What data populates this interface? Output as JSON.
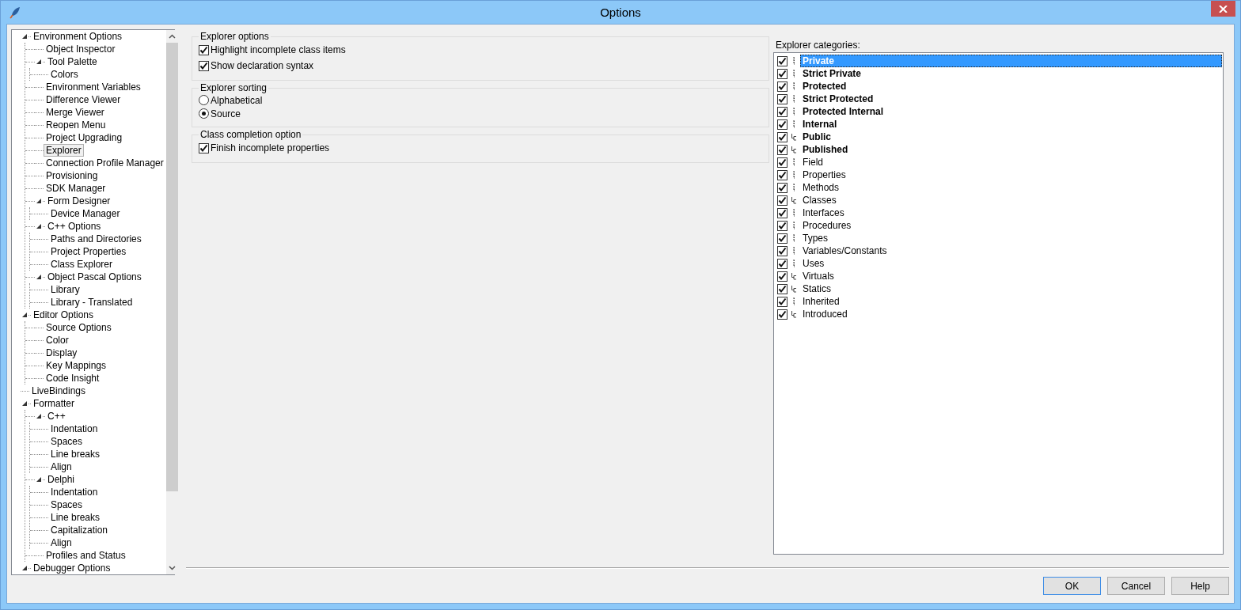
{
  "window": {
    "title": "Options"
  },
  "tree": [
    {
      "label": "Environment Options",
      "expanded": true,
      "selected": false,
      "children": [
        {
          "label": "Object Inspector",
          "selected": false
        },
        {
          "label": "Tool Palette",
          "expanded": true,
          "selected": false,
          "children": [
            {
              "label": "Colors",
              "selected": false
            }
          ]
        },
        {
          "label": "Environment Variables",
          "selected": false
        },
        {
          "label": "Difference Viewer",
          "selected": false
        },
        {
          "label": "Merge Viewer",
          "selected": false
        },
        {
          "label": "Reopen Menu",
          "selected": false
        },
        {
          "label": "Project Upgrading",
          "selected": false
        },
        {
          "label": "Explorer",
          "selected": true
        },
        {
          "label": "Connection Profile Manager",
          "selected": false
        },
        {
          "label": "Provisioning",
          "selected": false
        },
        {
          "label": "SDK Manager",
          "selected": false
        },
        {
          "label": "Form Designer",
          "expanded": true,
          "selected": false,
          "children": [
            {
              "label": "Device Manager",
              "selected": false
            }
          ]
        },
        {
          "label": "C++ Options",
          "expanded": true,
          "selected": false,
          "children": [
            {
              "label": "Paths and Directories",
              "selected": false
            },
            {
              "label": "Project Properties",
              "selected": false
            },
            {
              "label": "Class Explorer",
              "selected": false
            }
          ]
        },
        {
          "label": "Object Pascal Options",
          "expanded": true,
          "selected": false,
          "children": [
            {
              "label": "Library",
              "selected": false
            },
            {
              "label": "Library - Translated",
              "selected": false
            }
          ]
        }
      ]
    },
    {
      "label": "Editor Options",
      "expanded": true,
      "selected": false,
      "children": [
        {
          "label": "Source Options",
          "selected": false
        },
        {
          "label": "Color",
          "selected": false
        },
        {
          "label": "Display",
          "selected": false
        },
        {
          "label": "Key Mappings",
          "selected": false
        },
        {
          "label": "Code Insight",
          "selected": false
        }
      ]
    },
    {
      "label": "LiveBindings",
      "selected": false
    },
    {
      "label": "Formatter",
      "expanded": true,
      "selected": false,
      "children": [
        {
          "label": "C++",
          "expanded": true,
          "selected": false,
          "children": [
            {
              "label": "Indentation",
              "selected": false
            },
            {
              "label": "Spaces",
              "selected": false
            },
            {
              "label": "Line breaks",
              "selected": false
            },
            {
              "label": "Align",
              "selected": false
            }
          ]
        },
        {
          "label": "Delphi",
          "expanded": true,
          "selected": false,
          "children": [
            {
              "label": "Indentation",
              "selected": false
            },
            {
              "label": "Spaces",
              "selected": false
            },
            {
              "label": "Line breaks",
              "selected": false
            },
            {
              "label": "Capitalization",
              "selected": false
            },
            {
              "label": "Align",
              "selected": false
            }
          ]
        },
        {
          "label": "Profiles and Status",
          "selected": false
        }
      ]
    },
    {
      "label": "Debugger Options",
      "expanded": true,
      "selected": false
    }
  ],
  "groups": [
    {
      "title": "Explorer options",
      "kind": "checkboxes",
      "options": [
        {
          "label": "Highlight incomplete class items",
          "checked": true
        },
        {
          "label": "Show declaration syntax",
          "checked": true
        }
      ]
    },
    {
      "title": "Explorer sorting",
      "kind": "radios",
      "options": [
        {
          "label": "Alphabetical",
          "selected": false
        },
        {
          "label": "Source",
          "selected": true
        }
      ]
    },
    {
      "title": "Class completion option",
      "kind": "checkboxes",
      "options": [
        {
          "label": "Finish incomplete properties",
          "checked": true
        }
      ]
    }
  ],
  "categories": {
    "label": "Explorer categories:",
    "items": [
      {
        "name": "Private",
        "checked": true,
        "bold": true,
        "kind": "member",
        "selected": true
      },
      {
        "name": "Strict Private",
        "checked": true,
        "bold": true,
        "kind": "member",
        "selected": false
      },
      {
        "name": "Protected",
        "checked": true,
        "bold": true,
        "kind": "member",
        "selected": false
      },
      {
        "name": "Strict Protected",
        "checked": true,
        "bold": true,
        "kind": "member",
        "selected": false
      },
      {
        "name": "Protected Internal",
        "checked": true,
        "bold": true,
        "kind": "member",
        "selected": false
      },
      {
        "name": "Internal",
        "checked": true,
        "bold": true,
        "kind": "member",
        "selected": false
      },
      {
        "name": "Public",
        "checked": true,
        "bold": true,
        "kind": "branch",
        "selected": false
      },
      {
        "name": "Published",
        "checked": true,
        "bold": true,
        "kind": "branch",
        "selected": false
      },
      {
        "name": "Field",
        "checked": true,
        "bold": false,
        "kind": "member",
        "selected": false
      },
      {
        "name": "Properties",
        "checked": true,
        "bold": false,
        "kind": "member",
        "selected": false
      },
      {
        "name": "Methods",
        "checked": true,
        "bold": false,
        "kind": "member",
        "selected": false
      },
      {
        "name": "Classes",
        "checked": true,
        "bold": false,
        "kind": "branch",
        "selected": false
      },
      {
        "name": "Interfaces",
        "checked": true,
        "bold": false,
        "kind": "member",
        "selected": false
      },
      {
        "name": "Procedures",
        "checked": true,
        "bold": false,
        "kind": "member",
        "selected": false
      },
      {
        "name": "Types",
        "checked": true,
        "bold": false,
        "kind": "member",
        "selected": false
      },
      {
        "name": "Variables/Constants",
        "checked": true,
        "bold": false,
        "kind": "member",
        "selected": false
      },
      {
        "name": "Uses",
        "checked": true,
        "bold": false,
        "kind": "member",
        "selected": false
      },
      {
        "name": "Virtuals",
        "checked": true,
        "bold": false,
        "kind": "branch",
        "selected": false
      },
      {
        "name": "Statics",
        "checked": true,
        "bold": false,
        "kind": "branch",
        "selected": false
      },
      {
        "name": "Inherited",
        "checked": true,
        "bold": false,
        "kind": "member",
        "selected": false
      },
      {
        "name": "Introduced",
        "checked": true,
        "bold": false,
        "kind": "branch",
        "selected": false
      }
    ]
  },
  "buttons": [
    {
      "label": "OK",
      "default": true
    },
    {
      "label": "Cancel",
      "default": false
    },
    {
      "label": "Help",
      "default": false
    }
  ]
}
